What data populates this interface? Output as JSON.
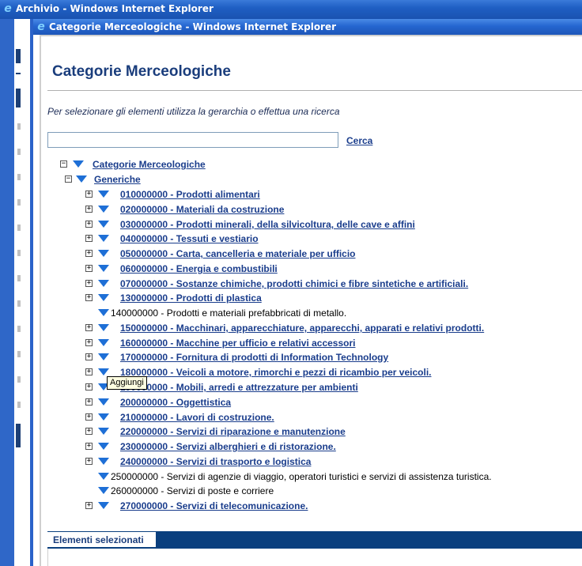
{
  "outer_window": {
    "title": "Archivio - Windows Internet Explorer"
  },
  "inner_window": {
    "title": "Categorie Merceologiche - Windows Internet Explorer"
  },
  "page": {
    "title": "Categorie Merceologiche",
    "instructions": "Per selezionare gli elementi utilizza la gerarchia o effettua una ricerca"
  },
  "search": {
    "value": "",
    "placeholder": "",
    "button_label": "Cerca"
  },
  "tree": {
    "root": {
      "label": "Categorie Merceologiche",
      "toggle": "−"
    },
    "group": {
      "label": "Generiche",
      "toggle": "−"
    },
    "items": [
      {
        "label": "010000000 - Prodotti alimentari",
        "expandable": true,
        "link": true
      },
      {
        "label": "020000000 - Materiali da costruzione",
        "expandable": true,
        "link": true
      },
      {
        "label": "030000000 - Prodotti minerali, della silvicoltura, delle cave e affini",
        "expandable": true,
        "link": true
      },
      {
        "label": "040000000 - Tessuti e vestiario",
        "expandable": true,
        "link": true
      },
      {
        "label": "050000000 - Carta, cancelleria e materiale per ufficio",
        "expandable": true,
        "link": true
      },
      {
        "label": "060000000 - Energia e combustibili",
        "expandable": true,
        "link": true
      },
      {
        "label": "070000000 - Sostanze chimiche, prodotti chimici e fibre sintetiche e artificiali.",
        "expandable": true,
        "link": true
      },
      {
        "label": "130000000 - Prodotti di plastica",
        "expandable": true,
        "link": true
      },
      {
        "label": "140000000 - Prodotti e materiali prefabbricati di metallo.",
        "expandable": false,
        "link": false
      },
      {
        "label": "150000000 - Macchinari, apparecchiature, apparecchi, apparati e relativi prodotti.",
        "expandable": true,
        "link": true
      },
      {
        "label": "160000000 - Macchine per ufficio e relativi accessori",
        "expandable": true,
        "link": true
      },
      {
        "label": "170000000 - Fornitura di prodotti di Information Technology",
        "expandable": true,
        "link": true
      },
      {
        "label": "180000000 - Veicoli a motore, rimorchi e pezzi di ricambio per veicoli.",
        "expandable": true,
        "link": true
      },
      {
        "label": "190000000 - Mobili, arredi e attrezzature per ambienti",
        "expandable": true,
        "link": true
      },
      {
        "label": "200000000 - Oggettistica",
        "expandable": true,
        "link": true
      },
      {
        "label": "210000000 - Lavori di costruzione.",
        "expandable": true,
        "link": true
      },
      {
        "label": "220000000 - Servizi di riparazione e manutenzione",
        "expandable": true,
        "link": true
      },
      {
        "label": "230000000 - Servizi alberghieri e di ristorazione.",
        "expandable": true,
        "link": true
      },
      {
        "label": "240000000 - Servizi di trasporto e logistica",
        "expandable": true,
        "link": true
      },
      {
        "label": "250000000 - Servizi di agenzie di viaggio, operatori turistici e servizi di assistenza turistica.",
        "expandable": false,
        "link": false
      },
      {
        "label": "260000000 - Servizi di poste e corriere",
        "expandable": false,
        "link": false
      },
      {
        "label": "270000000 - Servizi di telecomunicazione.",
        "expandable": true,
        "link": true
      }
    ]
  },
  "tooltip": {
    "text": "Aggiungi"
  },
  "selected_panel": {
    "label": "Elementi selezionati"
  },
  "icons": {
    "expand": "+",
    "collapse": "−",
    "node_arrow": "blue-down-triangle-icon",
    "browser": "internet-explorer-icon"
  },
  "colors": {
    "titlebar": "#2566d0",
    "link": "#1a3d8c",
    "heading": "#1a3d7c",
    "arrow": "#1e6fd6",
    "panel_bar": "#0a3f7e"
  }
}
